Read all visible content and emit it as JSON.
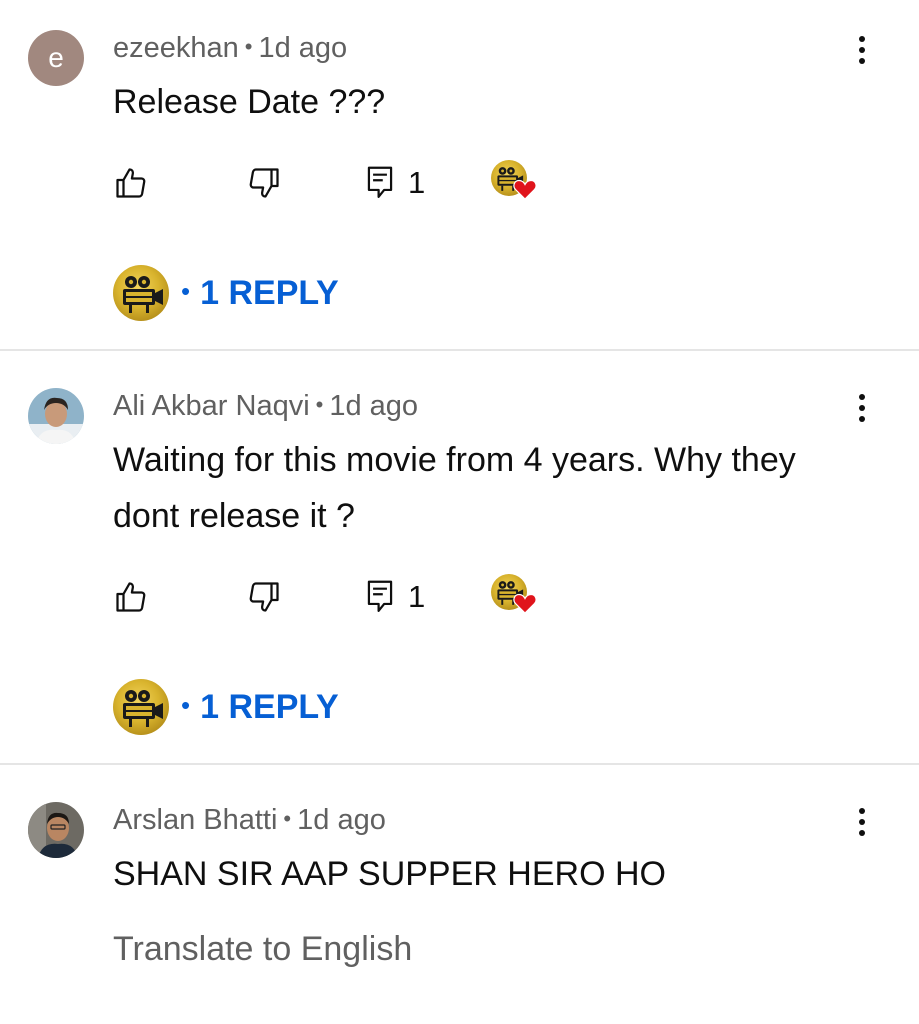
{
  "colors": {
    "link_blue": "#065fd4",
    "meta_gray": "#606060",
    "heart_red": "#e0141b",
    "logo_gold": "#d9b42e"
  },
  "comments": [
    {
      "avatar": {
        "type": "letter",
        "letter": "e"
      },
      "author": "ezeekhan",
      "separator": "•",
      "time": "1d ago",
      "text": "Release Date ???",
      "reply_count_icon": "1",
      "hearted_by_creator": true,
      "view_replies_label": "1 REPLY",
      "view_replies_dot": "•"
    },
    {
      "avatar": {
        "type": "photo",
        "description_icon": "user-photo"
      },
      "author": "Ali Akbar Naqvi",
      "separator": "•",
      "time": "1d ago",
      "text": "Waiting for this movie from 4 years. Why they dont release it ?",
      "reply_count_icon": "1",
      "hearted_by_creator": true,
      "view_replies_label": "1 REPLY",
      "view_replies_dot": "•"
    },
    {
      "avatar": {
        "type": "photo",
        "description_icon": "user-photo"
      },
      "author": "Arslan Bhatti",
      "separator": "•",
      "time": "1d ago",
      "text": "SHAN SIR AAP SUPPER HERO HO",
      "translate_label": "Translate to English"
    }
  ],
  "icons": {
    "like": "thumbs-up-icon",
    "dislike": "thumbs-down-icon",
    "reply": "comment-icon",
    "more": "more-vert-icon",
    "heart": "heart-icon"
  }
}
